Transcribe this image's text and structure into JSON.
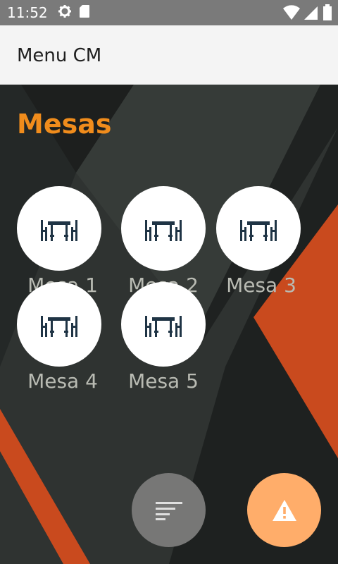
{
  "status_bar": {
    "time": "11:52",
    "icons_left": [
      "gear-icon",
      "sd-card-icon"
    ],
    "icons_right": [
      "wifi-icon",
      "signal-icon",
      "battery-icon"
    ]
  },
  "app_bar": {
    "title": "Menu CM",
    "background": "#f4f4f4"
  },
  "section": {
    "title": "Mesas",
    "title_color": "#f08c1c"
  },
  "tables": [
    {
      "label": "Mesa 1",
      "icon": "dining-table-icon"
    },
    {
      "label": "Mesa 2",
      "icon": "dining-table-icon"
    },
    {
      "label": "Mesa 3",
      "icon": "dining-table-icon"
    },
    {
      "label": "Mesa 4",
      "icon": "dining-table-icon"
    },
    {
      "label": "Mesa 5",
      "icon": "dining-table-icon"
    }
  ],
  "fabs": [
    {
      "name": "list-fab",
      "icon": "sort-list-icon",
      "color": "#777776"
    },
    {
      "name": "alert-fab",
      "icon": "warning-icon",
      "color": "#ffad6a"
    }
  ],
  "colors": {
    "accent": "#f08c1c",
    "background_dark": "#212423",
    "stripe_orange": "#c94a1e"
  }
}
